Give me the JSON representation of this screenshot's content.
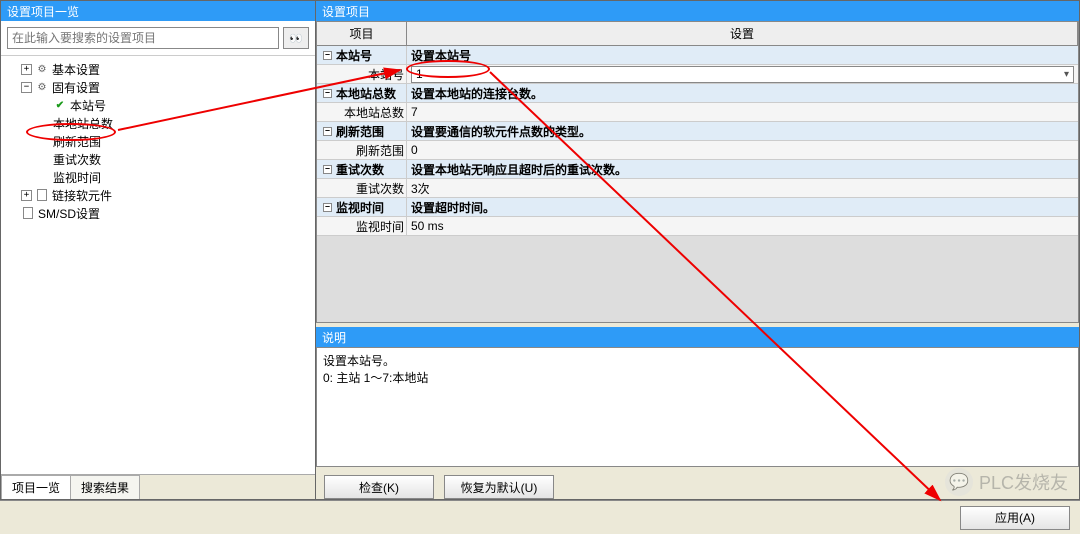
{
  "left": {
    "title": "设置项目一览",
    "search_placeholder": "在此输入要搜索的设置项目",
    "tree": {
      "basic": "基本设置",
      "intrinsic": "固有设置",
      "own_station": "本站号",
      "local_total": "本地站总数",
      "refresh_range": "刷新范围",
      "retry_count": "重试次数",
      "monitor_time": "监视时间",
      "link_soft": "链接软元件",
      "smsd": "SM/SD设置"
    },
    "tabs": {
      "list": "项目一览",
      "search": "搜索结果"
    }
  },
  "right": {
    "title": "设置项目",
    "columns": {
      "item": "项目",
      "setting": "设置"
    },
    "rows": {
      "own_station_section": "本站号",
      "own_station_desc": "设置本站号",
      "own_station_label": "本站号",
      "own_station_value": "1",
      "local_total_section": "本地站总数",
      "local_total_desc": "设置本地站的连接台数。",
      "local_total_label": "本地站总数",
      "local_total_value": "7",
      "refresh_section": "刷新范围",
      "refresh_desc": "设置要通信的软元件点数的类型。",
      "refresh_label": "刷新范围",
      "refresh_value": "0",
      "retry_section": "重试次数",
      "retry_desc": "设置本地站无响应且超时后的重试次数。",
      "retry_label": "重试次数",
      "retry_value": "3次",
      "monitor_section": "监视时间",
      "monitor_desc": "设置超时时间。",
      "monitor_label": "监视时间",
      "monitor_value": "50 ms"
    },
    "desc_title": "说明",
    "desc_body": "设置本站号。\n  0: 主站    1～7:本地站",
    "buttons": {
      "check": "检查(K)",
      "restore": "恢复为默认(U)",
      "apply": "应用(A)"
    }
  },
  "watermark": "PLC发烧友"
}
